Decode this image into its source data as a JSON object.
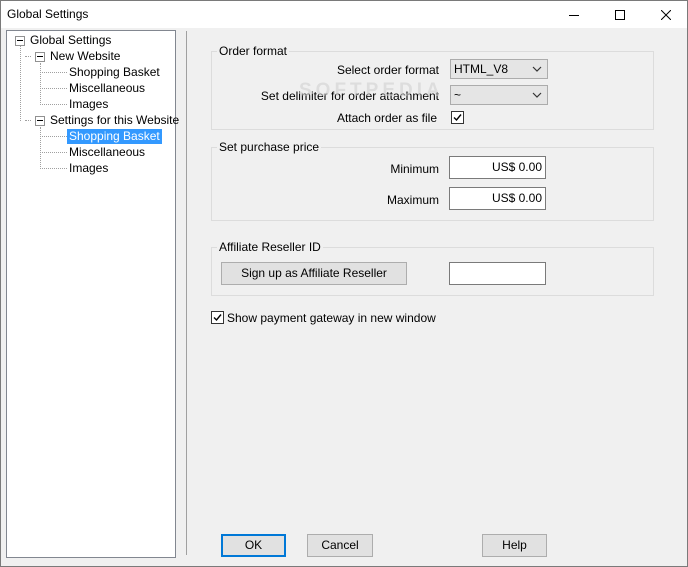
{
  "window": {
    "title": "Global Settings"
  },
  "tree": {
    "root": "Global Settings",
    "new_website": {
      "label": "New Website",
      "children": [
        "Shopping Basket",
        "Miscellaneous",
        "Images"
      ]
    },
    "this_website": {
      "label": "Settings for this Website",
      "children": [
        "Shopping Basket",
        "Miscellaneous",
        "Images"
      ]
    },
    "selected": "Shopping Basket"
  },
  "order_format": {
    "group_label": "Order format",
    "select_label": "Select order format",
    "select_value": "HTML_V8",
    "delimiter_label": "Set delimiter for order attachment",
    "delimiter_value": "~",
    "attach_label": "Attach order as file",
    "attach_checked": true
  },
  "purchase_price": {
    "group_label": "Set purchase price",
    "min_label": "Minimum",
    "min_value": "US$ 0.00",
    "max_label": "Maximum",
    "max_value": "US$ 0.00"
  },
  "affiliate": {
    "group_label": "Affiliate Reseller ID",
    "signup_label": "Sign up as Affiliate Reseller",
    "id_value": ""
  },
  "payment_gateway": {
    "label": "Show payment gateway in new window",
    "checked": true
  },
  "footer": {
    "ok_label": "OK",
    "cancel_label": "Cancel",
    "help_label": "Help"
  },
  "watermark": "SOFTPEDIA"
}
